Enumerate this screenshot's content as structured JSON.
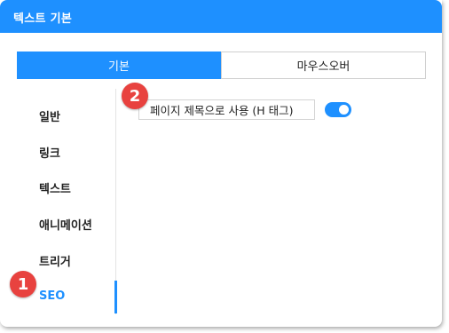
{
  "header": {
    "title": "텍스트 기본"
  },
  "tabs": [
    {
      "label": "기본",
      "active": true
    },
    {
      "label": "마우스오버",
      "active": false
    }
  ],
  "sidebar": {
    "items": [
      {
        "label": "일반"
      },
      {
        "label": "링크"
      },
      {
        "label": "텍스트"
      },
      {
        "label": "애니메이션"
      },
      {
        "label": "트리거"
      },
      {
        "label": "SEO",
        "active": true
      }
    ]
  },
  "content": {
    "option_label": "페이지 제목으로 사용 (H 태그)",
    "toggle_on": true
  },
  "badges": {
    "first": "1",
    "second": "2"
  },
  "colors": {
    "accent": "#1e90ff",
    "badge": "#e8423f"
  }
}
